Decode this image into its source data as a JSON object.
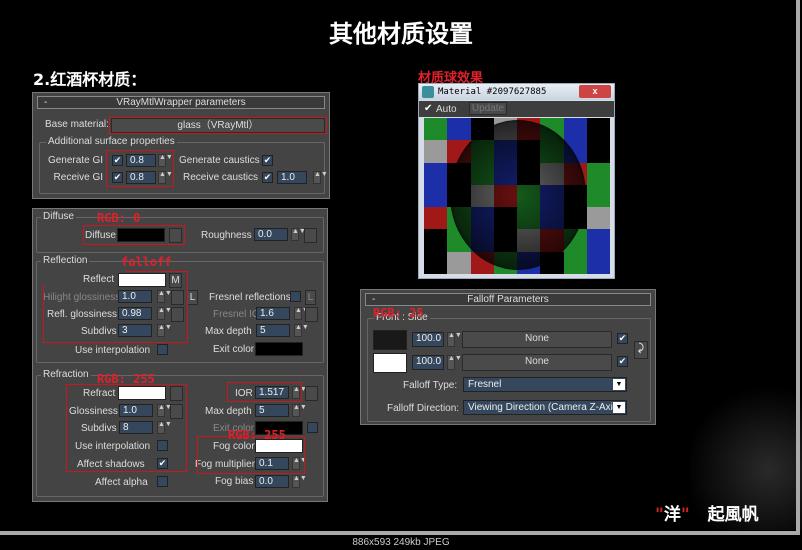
{
  "title": "其他材质设置",
  "subtitle": "2.红酒杯材质：",
  "wrapper": {
    "header": "VRayMtlWrapper parameters",
    "collapse": "-",
    "base_material_label": "Base material:",
    "base_material": "glass（VRayMtl）",
    "group": "Additional surface properties",
    "generate_gi_label": "Generate GI",
    "generate_gi": "0.8",
    "receive_gi_label": "Receive GI",
    "receive_gi": "0.8",
    "generate_caustics_label": "Generate caustics",
    "receive_caustics_label": "Receive caustics",
    "receive_caustics": "1.0",
    "check": "✔"
  },
  "diffuse": {
    "group": "Diffuse",
    "annotation": "RGB: 0",
    "diffuse_label": "Diffuse",
    "roughness_label": "Roughness",
    "roughness": "0.0"
  },
  "reflection": {
    "group": "Reflection",
    "annotation": "falloff",
    "reflect_label": "Reflect",
    "m": "M",
    "hilight_label": "Hilight glossiness",
    "hilight": "1.0",
    "l": "L",
    "refl_gloss_label": "Refl. glossiness",
    "refl_gloss": "0.98",
    "subdivs_label": "Subdivs",
    "subdivs": "3",
    "use_interp_label": "Use interpolation",
    "fresnel_label": "Fresnel reflections",
    "fresnel_ior_label": "Fresnel IOR",
    "fresnel_ior": "1.6",
    "max_depth_label": "Max depth",
    "max_depth": "5",
    "exit_color_label": "Exit color"
  },
  "refraction": {
    "group": "Refraction",
    "annotation": "RGB: 255",
    "refract_label": "Refract",
    "glossiness_label": "Glossiness",
    "glossiness": "1.0",
    "subdivs_label": "Subdivs",
    "subdivs": "8",
    "use_interp_label": "Use interpolation",
    "affect_shadows_label": "Affect shadows",
    "affect_alpha_label": "Affect alpha",
    "ior_label": "IOR",
    "ior": "1.517",
    "max_depth_label": "Max depth",
    "max_depth": "5",
    "exit_color_label": "Exit color",
    "fog_annotation": "RGB: 255",
    "fog_color_label": "Fog color",
    "fog_mult_label": "Fog multiplier",
    "fog_mult": "0.1",
    "fog_bias_label": "Fog bias",
    "fog_bias": "0.0"
  },
  "material_preview": {
    "annotation": "材质球效果",
    "window_title": "Material #2097627885",
    "close": "x",
    "auto_label": "Auto",
    "update_label": "Update"
  },
  "falloff": {
    "header": "Falloff Parameters",
    "collapse": "-",
    "annotation": "RGB: 25",
    "group": "Front : Side",
    "front_amount": "100.0",
    "side_amount": "100.0",
    "front_map": "None",
    "side_map": "None",
    "swap": "⤸",
    "type_label": "Falloff Type:",
    "type": "Fresnel",
    "direction_label": "Falloff Direction:",
    "direction": "Viewing Direction (Camera Z-Axis)"
  },
  "signature": {
    "quote_open": "\"",
    "name1": "洋",
    "quote_close": "\"",
    "name2": "起風帆"
  },
  "status_bar": "886x593  249kb  JPEG"
}
